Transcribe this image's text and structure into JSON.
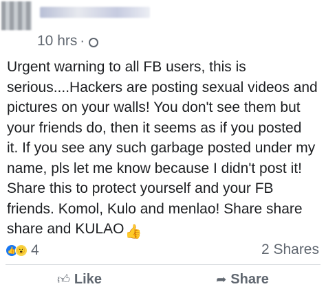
{
  "post": {
    "timestamp": "10 hrs",
    "separator": "·",
    "text_lines": [
      "Urgent warning to all FB users, this is",
      "serious....Hackers are posting sexual videos and",
      "pictures on your walls! You don't see them but",
      "your friends do, then it seems as if you posted",
      "it. If you see any such garbage posted under my",
      "name, pls let me know because I didn't post it!",
      "Share this to protect yourself and your FB",
      "friends. Komol, Kulo and menlao! Share share",
      "share and KULAO"
    ],
    "thumb_emoji": "👍"
  },
  "reactions": {
    "icons": [
      "like-reaction",
      "wow-reaction"
    ],
    "count": "4",
    "shares": "2 Shares"
  },
  "actions": {
    "like_label": "Like",
    "share_label": "Share"
  }
}
